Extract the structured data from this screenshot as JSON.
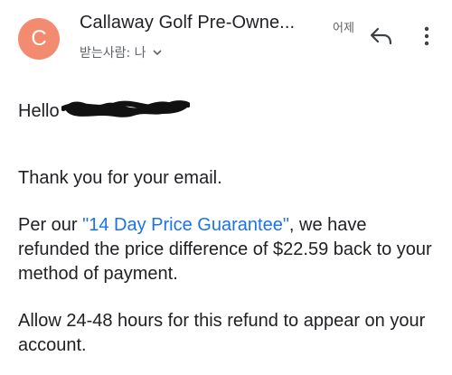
{
  "colors": {
    "avatar_bg": "#F28B70",
    "link": "#1a73e8",
    "text": "#202124",
    "secondary": "#5f6368"
  },
  "header": {
    "avatar_letter": "C",
    "sender": "Callaway Golf Pre-Owne...",
    "date": "어제",
    "recipient": "받는사람: 나",
    "icons": {
      "recipient_toggle": "chevron-down-icon",
      "reply": "reply-icon",
      "more": "more-vert-icon"
    }
  },
  "body": {
    "greeting": "Hello",
    "thanks": "Thank you for your email.",
    "refund_prefix": "Per our ",
    "refund_link": "\"14 Day Price Guarantee\"",
    "refund_suffix": ", we have refunded the price difference of $22.59 back to your method of payment.",
    "allow": "Allow 24-48 hours for this refund to appear on your account."
  }
}
